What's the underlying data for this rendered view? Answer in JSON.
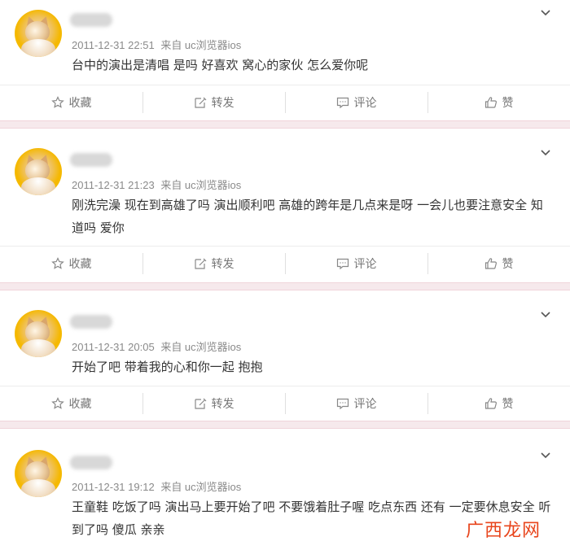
{
  "posts": [
    {
      "timestamp": "2011-12-31 22:51",
      "source": "来自 uc浏览器ios",
      "text": "台中的演出是清唱 是吗 好喜欢 窝心的家伙 怎么爱你呢",
      "actions": {
        "favorite": "收藏",
        "repost": "转发",
        "comment": "评论",
        "like": "赞"
      }
    },
    {
      "timestamp": "2011-12-31 21:23",
      "source": "来自 uc浏览器ios",
      "text": "刚洗完澡 现在到高雄了吗 演出顺利吧 高雄的跨年是几点来是呀 一会儿也要注意安全 知道吗 爱你",
      "actions": {
        "favorite": "收藏",
        "repost": "转发",
        "comment": "评论",
        "like": "赞"
      }
    },
    {
      "timestamp": "2011-12-31 20:05",
      "source": "来自 uc浏览器ios",
      "text": "开始了吧 带着我的心和你一起 抱抱",
      "actions": {
        "favorite": "收藏",
        "repost": "转发",
        "comment": "评论",
        "like": "赞"
      }
    },
    {
      "timestamp": "2011-12-31 19:12",
      "source": "来自 uc浏览器ios",
      "text": "王童鞋 吃饭了吗 演出马上要开始了吧 不要饿着肚子喔 吃点东西 还有 一定要休息安全 听到了吗 傻瓜 亲亲"
    }
  ],
  "watermark": "广西龙网",
  "colors": {
    "separator": "#f6e9ec",
    "watermark": "#e8451c",
    "meta": "#8a8a8a"
  },
  "icons": {
    "favorite": "star-icon",
    "repost": "edit-icon",
    "comment": "comment-icon",
    "like": "thumbs-up-icon",
    "menu": "chevron-down-icon"
  }
}
